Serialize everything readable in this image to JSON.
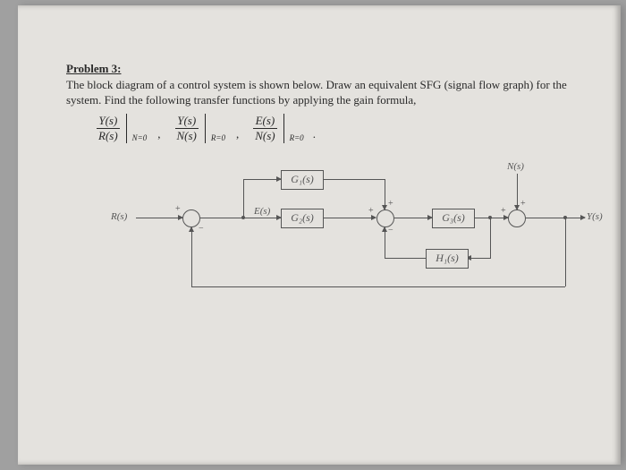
{
  "problem": {
    "heading": "Problem 3:",
    "text": "The block diagram of a control system is shown below. Draw an equivalent SFG (signal flow graph) for the system. Find the following transfer functions by applying the gain formula,"
  },
  "formulas": [
    {
      "num": "Y(s)",
      "den": "R(s)",
      "cond": "N=0"
    },
    {
      "num": "Y(s)",
      "den": "N(s)",
      "cond": "R=0"
    },
    {
      "num": "E(s)",
      "den": "N(s)",
      "cond": "R=0"
    }
  ],
  "signals": {
    "R": "R(s)",
    "E": "E(s)",
    "N": "N(s)",
    "Y": "Y(s)"
  },
  "blocks": {
    "G1": "G₁(s)",
    "G2": "G₂(s)",
    "G3": "G₃(s)",
    "H1": "H₁(s)"
  },
  "signs": {
    "plus": "+",
    "minus": "−"
  },
  "chart_data": {
    "type": "block_diagram",
    "nodes": [
      {
        "id": "R",
        "kind": "input",
        "label": "R(s)"
      },
      {
        "id": "S1",
        "kind": "sum",
        "inputs": [
          {
            "from": "R",
            "sign": "+"
          },
          {
            "from": "Y",
            "sign": "-"
          }
        ]
      },
      {
        "id": "E",
        "kind": "signal",
        "label": "E(s)"
      },
      {
        "id": "G1",
        "kind": "block",
        "label": "G1(s)"
      },
      {
        "id": "G2",
        "kind": "block",
        "label": "G2(s)"
      },
      {
        "id": "S2",
        "kind": "sum",
        "inputs": [
          {
            "from": "G1",
            "sign": "+"
          },
          {
            "from": "G2",
            "sign": "+"
          },
          {
            "from": "H1",
            "sign": "-"
          }
        ]
      },
      {
        "id": "G3",
        "kind": "block",
        "label": "G3(s)"
      },
      {
        "id": "N",
        "kind": "input",
        "label": "N(s)"
      },
      {
        "id": "S3",
        "kind": "sum",
        "inputs": [
          {
            "from": "G3",
            "sign": "+"
          },
          {
            "from": "N",
            "sign": "+"
          }
        ]
      },
      {
        "id": "H1",
        "kind": "block",
        "label": "H1(s)"
      },
      {
        "id": "Y",
        "kind": "output",
        "label": "Y(s)"
      }
    ],
    "edges": [
      [
        "R",
        "S1"
      ],
      [
        "S1",
        "E"
      ],
      [
        "E",
        "G1"
      ],
      [
        "E",
        "G2"
      ],
      [
        "G1",
        "S2"
      ],
      [
        "G2",
        "S2"
      ],
      [
        "S2",
        "G3"
      ],
      [
        "G3",
        "S3"
      ],
      [
        "N",
        "S3"
      ],
      [
        "S3",
        "Y"
      ],
      [
        "Y",
        "H1"
      ],
      [
        "H1",
        "S2"
      ],
      [
        "Y",
        "S1"
      ]
    ]
  }
}
